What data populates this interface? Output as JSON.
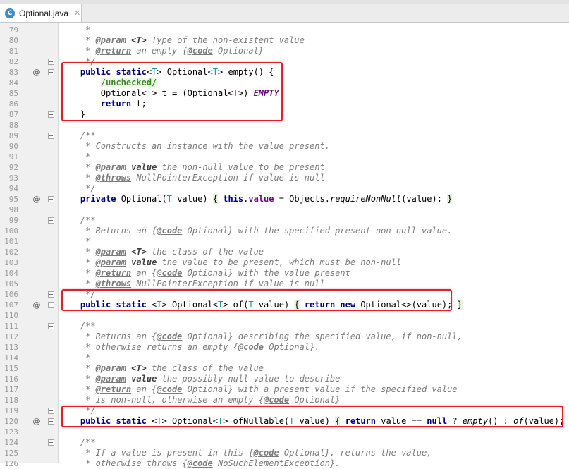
{
  "tab": {
    "label": "Optional.java",
    "icon": "c-class-icon",
    "icon_text": "C",
    "close": "✕"
  },
  "lines": [
    {
      "n": "79",
      "ann": "",
      "fold": "",
      "code": "<span class=\"c\">     *</span>"
    },
    {
      "n": "80",
      "ann": "",
      "fold": "",
      "code": "<span class=\"c\">     * <span class=\"dt\">@param</span> <span class=\"dp\">&lt;T&gt;</span> Type of the non-existent value</span>"
    },
    {
      "n": "81",
      "ann": "",
      "fold": "",
      "code": "<span class=\"c\">     * <span class=\"dt\">@return</span> an empty {<span class=\"dt\">@code</span> Optional}</span>"
    },
    {
      "n": "82",
      "ann": "",
      "fold": "minus",
      "code": "<span class=\"c\">     */</span>"
    },
    {
      "n": "83",
      "ann": "@",
      "fold": "minus",
      "code": "    <span class=\"k\">public static</span>&lt;<span class=\"tp\">T</span>&gt; Optional&lt;<span class=\"tp\">T</span>&gt; empty() {"
    },
    {
      "n": "84",
      "ann": "",
      "fold": "",
      "code": "        <span class=\"ann-str\">/unchecked/</span>"
    },
    {
      "n": "85",
      "ann": "",
      "fold": "",
      "code": "        Optional&lt;<span class=\"tp\">T</span>&gt; t = (Optional&lt;<span class=\"tp\">T</span>&gt;) <span class=\"fi\">EMPTY</span>;"
    },
    {
      "n": "86",
      "ann": "",
      "fold": "",
      "code": "        <span class=\"k\">return</span> t;"
    },
    {
      "n": "87",
      "ann": "",
      "fold": "minus",
      "code": "    }"
    },
    {
      "n": "88",
      "ann": "",
      "fold": "",
      "code": ""
    },
    {
      "n": "89",
      "ann": "",
      "fold": "minus",
      "code": "<span class=\"c\">    /**</span>"
    },
    {
      "n": "90",
      "ann": "",
      "fold": "",
      "code": "<span class=\"c\">     * Constructs an instance with the value present.</span>"
    },
    {
      "n": "91",
      "ann": "",
      "fold": "",
      "code": "<span class=\"c\">     *</span>"
    },
    {
      "n": "92",
      "ann": "",
      "fold": "",
      "code": "<span class=\"c\">     * <span class=\"dt\">@param</span> <span class=\"dp\">value</span> the non-null value to be present</span>"
    },
    {
      "n": "93",
      "ann": "",
      "fold": "",
      "code": "<span class=\"c\">     * <span class=\"dt\">@throws</span> NullPointerException if value is null</span>"
    },
    {
      "n": "94",
      "ann": "",
      "fold": "",
      "code": "<span class=\"c\">     */</span>"
    },
    {
      "n": "95",
      "ann": "@",
      "fold": "plus",
      "code": "    <span class=\"k\">private</span> Optional(<span class=\"tp\">T</span> value) <span class=\"brace\">{</span> <span class=\"k\">this</span>.<span class=\"f\">value</span> = Objects.<span class=\"st\">requireNonNull</span>(value); <span class=\"brace\">}</span>"
    },
    {
      "n": "98",
      "ann": "",
      "fold": "",
      "code": ""
    },
    {
      "n": "99",
      "ann": "",
      "fold": "minus",
      "code": "<span class=\"c\">    /**</span>"
    },
    {
      "n": "100",
      "ann": "",
      "fold": "",
      "code": "<span class=\"c\">     * Returns an {<span class=\"dt\">@code</span> Optional} with the specified present non-null value.</span>"
    },
    {
      "n": "101",
      "ann": "",
      "fold": "",
      "code": "<span class=\"c\">     *</span>"
    },
    {
      "n": "102",
      "ann": "",
      "fold": "",
      "code": "<span class=\"c\">     * <span class=\"dt\">@param</span> <span class=\"dp\">&lt;T&gt;</span> the class of the value</span>"
    },
    {
      "n": "103",
      "ann": "",
      "fold": "",
      "code": "<span class=\"c\">     * <span class=\"dt\">@param</span> <span class=\"dp\">value</span> the value to be present, which must be non-null</span>"
    },
    {
      "n": "104",
      "ann": "",
      "fold": "",
      "code": "<span class=\"c\">     * <span class=\"dt\">@return</span> an {<span class=\"dt\">@code</span> Optional} with the value present</span>"
    },
    {
      "n": "105",
      "ann": "",
      "fold": "",
      "code": "<span class=\"c\">     * <span class=\"dt\">@throws</span> NullPointerException if value is null</span>"
    },
    {
      "n": "106",
      "ann": "",
      "fold": "minus",
      "code": "<span class=\"c\">     */</span>"
    },
    {
      "n": "107",
      "ann": "@",
      "fold": "plus",
      "code": "    <span class=\"k\">public static</span> &lt;<span class=\"tp\">T</span>&gt; Optional&lt;<span class=\"tp\">T</span>&gt; of(<span class=\"tp\">T</span> value) <span class=\"brace\">{</span> <span class=\"k\">return new</span> Optional&lt;&gt;(value); <span class=\"brace\">}</span>"
    },
    {
      "n": "110",
      "ann": "",
      "fold": "",
      "code": ""
    },
    {
      "n": "111",
      "ann": "",
      "fold": "minus",
      "code": "<span class=\"c\">    /**</span>"
    },
    {
      "n": "112",
      "ann": "",
      "fold": "",
      "code": "<span class=\"c\">     * Returns an {<span class=\"dt\">@code</span> Optional} describing the specified value, if non-null,</span>"
    },
    {
      "n": "113",
      "ann": "",
      "fold": "",
      "code": "<span class=\"c\">     * otherwise returns an empty {<span class=\"dt\">@code</span> Optional}.</span>"
    },
    {
      "n": "114",
      "ann": "",
      "fold": "",
      "code": "<span class=\"c\">     *</span>"
    },
    {
      "n": "115",
      "ann": "",
      "fold": "",
      "code": "<span class=\"c\">     * <span class=\"dt\">@param</span> <span class=\"dp\">&lt;T&gt;</span> the class of the value</span>"
    },
    {
      "n": "116",
      "ann": "",
      "fold": "",
      "code": "<span class=\"c\">     * <span class=\"dt\">@param</span> <span class=\"dp\">value</span> the possibly-null value to describe</span>"
    },
    {
      "n": "117",
      "ann": "",
      "fold": "",
      "code": "<span class=\"c\">     * <span class=\"dt\">@return</span> an {<span class=\"dt\">@code</span> Optional} with a present value if the specified value</span>"
    },
    {
      "n": "118",
      "ann": "",
      "fold": "",
      "code": "<span class=\"c\">     * is non-null, otherwise an empty {<span class=\"dt\">@code</span> Optional}</span>"
    },
    {
      "n": "119",
      "ann": "",
      "fold": "minus",
      "code": "<span class=\"c\">     */</span>"
    },
    {
      "n": "120",
      "ann": "@",
      "fold": "plus",
      "code": "    <span class=\"k\">public static</span> &lt;<span class=\"tp\">T</span>&gt; Optional&lt;<span class=\"tp\">T</span>&gt; ofNullable(<span class=\"tp\">T</span> value) <span class=\"brace\">{</span> <span class=\"k\">return</span> value == <span class=\"k\">null</span> ? <span class=\"st\">empty</span>() : <span class=\"st\">of</span>(value); <span class=\"brace\">}</span>"
    },
    {
      "n": "123",
      "ann": "",
      "fold": "",
      "code": ""
    },
    {
      "n": "124",
      "ann": "",
      "fold": "minus",
      "code": "<span class=\"c\">    /**</span>"
    },
    {
      "n": "125",
      "ann": "",
      "fold": "",
      "code": "<span class=\"c\">     * If a value is present in this {<span class=\"dt\">@code</span> Optional}, returns the value,</span>"
    },
    {
      "n": "126",
      "ann": "",
      "fold": "",
      "code": "<span class=\"c\">     * otherwise throws {<span class=\"dt\">@code</span> NoSuchElementException}.</span>"
    }
  ],
  "highlights": [
    {
      "name": "highlight-empty-method"
    },
    {
      "name": "highlight-of-method"
    },
    {
      "name": "highlight-ofnullable-method"
    }
  ]
}
